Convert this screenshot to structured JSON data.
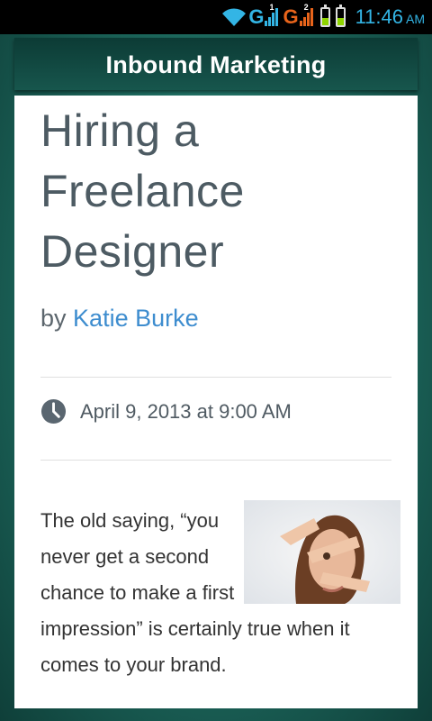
{
  "status_bar": {
    "network_1": "G",
    "sim_1": "1",
    "network_2": "G",
    "sim_2": "2",
    "time": "11:46",
    "ampm": "AM"
  },
  "header": {
    "title": "Inbound Marketing"
  },
  "article": {
    "title_lines": [
      "Hiring a",
      "Freelance",
      "Designer"
    ],
    "by": "by",
    "author": "Katie Burke",
    "date": "April 9, 2013 at 9:00 AM",
    "body": "The old saying, “you never get a second chance to make a first impression” is certainly true when it comes to your brand."
  },
  "colors": {
    "accent": "#33b5e5",
    "author_link": "#3e8dcf",
    "header_bg": "#0c3b35"
  }
}
